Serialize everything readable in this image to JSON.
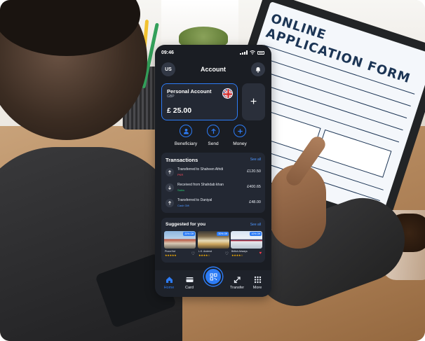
{
  "status_bar": {
    "time": "09:46"
  },
  "header": {
    "avatar_initials": "US",
    "title": "Account"
  },
  "account": {
    "name": "Personal Account",
    "currency": "GBP",
    "balance": "£ 25.00",
    "add_label": "+"
  },
  "quick_actions": [
    {
      "label": "Beneficiary",
      "icon": "user-icon"
    },
    {
      "label": "Send",
      "icon": "arrow-up-icon"
    },
    {
      "label": "Money",
      "icon": "plus-icon"
    }
  ],
  "transactions": {
    "title": "Transactions",
    "see_all": "See all",
    "items": [
      {
        "description": "Transferred to Shaheen Afridi",
        "tag": "PKR",
        "amount": "£120.50",
        "direction": "up",
        "tag_color": "#ff4d5e"
      },
      {
        "description": "Received from Shahdab khan",
        "tag": "Sales",
        "amount": "£400.65",
        "direction": "down",
        "tag_color": "#29c56e"
      },
      {
        "description": "Transferred to Daniyal",
        "tag": "Cash Gift",
        "amount": "£48.00",
        "direction": "up",
        "tag_color": "#4d96ff"
      }
    ]
  },
  "suggested": {
    "title": "Suggested for you",
    "see_all": "See all",
    "items": [
      {
        "badge": "20% Off",
        "name": "Pizza Hut",
        "stars": "★★★★★"
      },
      {
        "badge": "30% Off",
        "name": "L.K. Anderst",
        "stars": "★★★★☆"
      },
      {
        "badge": "10% Off",
        "name": "British Airways",
        "stars": "★★★★☆"
      }
    ]
  },
  "nav": [
    {
      "label": "Home",
      "active": true
    },
    {
      "label": "Card",
      "active": false
    },
    {
      "label": "Transfer",
      "active": false
    },
    {
      "label": "More",
      "active": false
    }
  ],
  "background": {
    "tablet_heading": "ONLINE APPLICATION FORM"
  },
  "colors": {
    "accent": "#2d7cf6",
    "app_bg": "#1a1d23",
    "card_bg": "#232833"
  }
}
